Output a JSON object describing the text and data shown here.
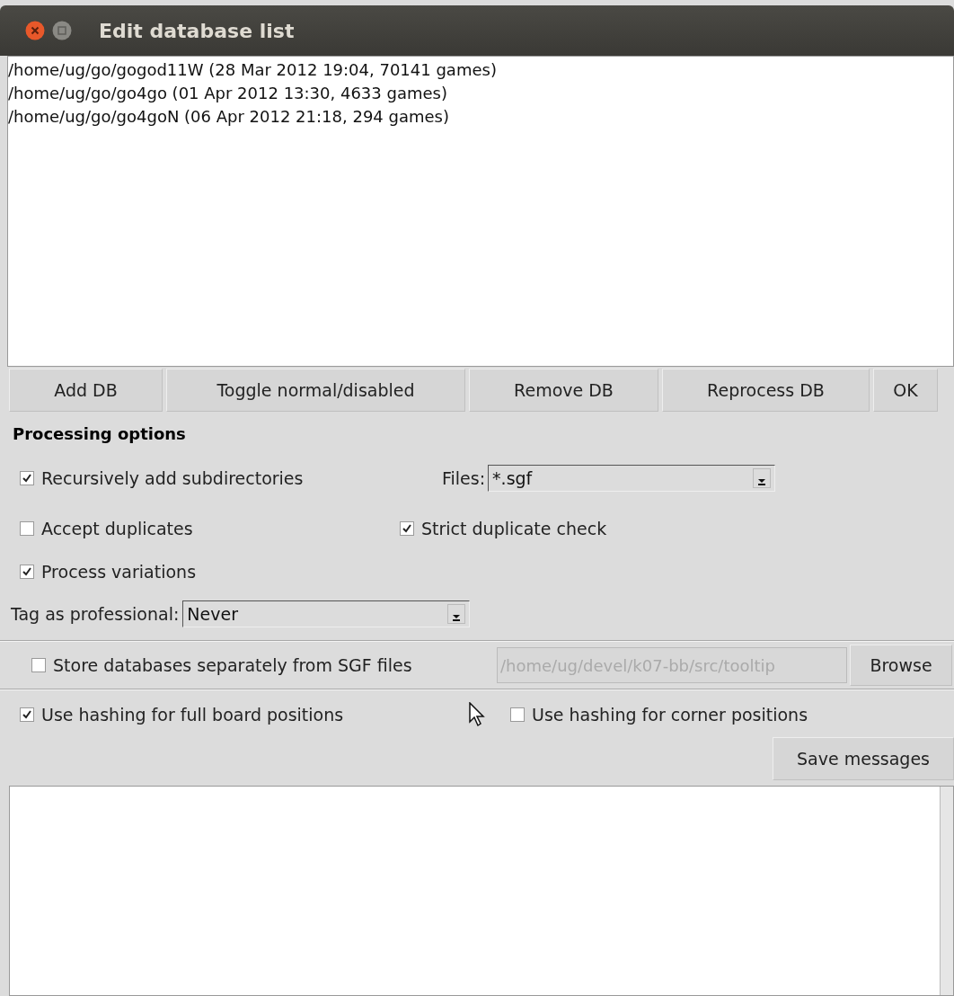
{
  "window": {
    "title": "Edit database list"
  },
  "database_list": [
    "/home/ug/go/gogod11W (28 Mar 2012 19:04, 70141 games)",
    "/home/ug/go/go4go (01 Apr 2012 13:30, 4633 games)",
    "/home/ug/go/go4goN (06 Apr 2012 21:18, 294 games)"
  ],
  "buttons": [
    "Add DB",
    "Toggle normal/disabled",
    "Remove DB",
    "Reprocess DB",
    "OK"
  ],
  "processing_options": {
    "heading": "Processing options",
    "recursive": {
      "label": "Recursively add subdirectories",
      "checked": true
    },
    "files": {
      "label": "Files:",
      "value": "*.sgf"
    },
    "accept_duplicates": {
      "label": "Accept duplicates",
      "checked": false
    },
    "strict_duplicate_check": {
      "label": "Strict duplicate check",
      "checked": true
    },
    "process_variations": {
      "label": "Process variations",
      "checked": true
    },
    "tag_as_professional": {
      "label": "Tag as professional:",
      "value": "Never"
    }
  },
  "storage": {
    "separate": {
      "label": "Store databases separately from SGF files",
      "checked": false
    },
    "path": {
      "value": "/home/ug/devel/k07-bb/src/tooltip",
      "disabled": true
    },
    "browse": "Browse"
  },
  "hashing": [
    {
      "label": "Use hashing for full board positions",
      "checked": true
    },
    {
      "label": "Use hashing for corner positions",
      "checked": false
    }
  ],
  "save_messages": "Save messages"
}
